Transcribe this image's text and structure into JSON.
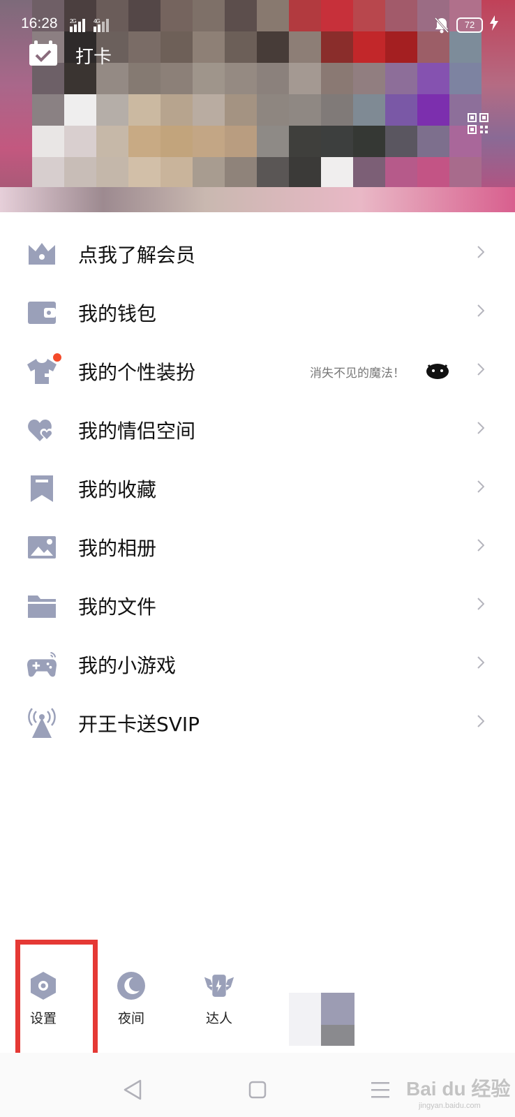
{
  "status_bar": {
    "time": "16:28",
    "signal_text": "2G 4G",
    "battery": "72"
  },
  "header": {
    "checkin_label": "打卡"
  },
  "menu": {
    "items": [
      {
        "label": "点我了解会员",
        "icon": "crown-icon"
      },
      {
        "label": "我的钱包",
        "icon": "wallet-icon"
      },
      {
        "label": "我的个性装扮",
        "icon": "tshirt-icon",
        "extra": "消失不见的魔法！",
        "badge": "red-dot"
      },
      {
        "label": "我的情侣空间",
        "icon": "hearts-icon"
      },
      {
        "label": "我的收藏",
        "icon": "bookmark-icon"
      },
      {
        "label": "我的相册",
        "icon": "photo-icon"
      },
      {
        "label": "我的文件",
        "icon": "folder-icon"
      },
      {
        "label": "我的小游戏",
        "icon": "gamepad-icon"
      },
      {
        "label": "开王卡送SVIP",
        "icon": "antenna-icon"
      }
    ]
  },
  "bottom_actions": {
    "settings": "设置",
    "night": "夜间",
    "expert": "达人"
  },
  "watermark": {
    "text": "Bai du 经验",
    "sub": "jingyan.baidu.com"
  },
  "colors": {
    "icon": "#9aa0b9",
    "highlight": "#e53935",
    "badge": "#f44a2a"
  }
}
